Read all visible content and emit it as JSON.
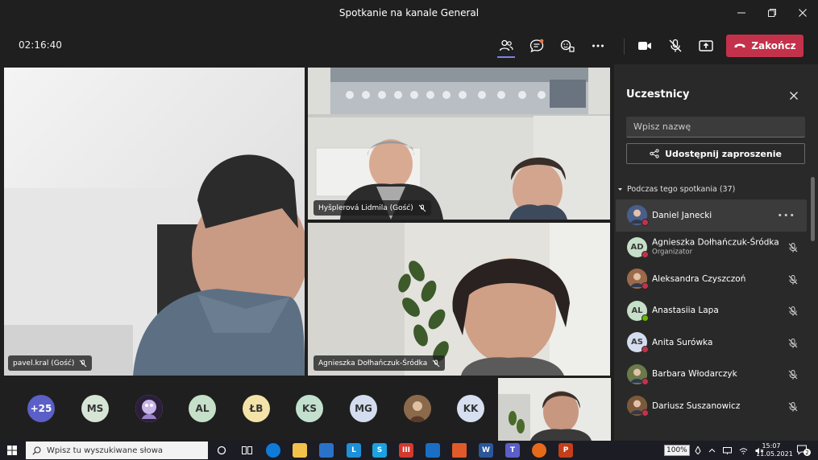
{
  "window": {
    "title": "Spotkanie na kanale General"
  },
  "toolbar": {
    "timer": "02:16:40",
    "leave_label": "Zakończ"
  },
  "tiles": [
    {
      "name": "pavel.kral (Gość)"
    },
    {
      "name": "Hyšplerová Lidmila (Gość)"
    },
    {
      "name": "Agnieszka Dołhańczuk-Śródka"
    }
  ],
  "strip": [
    {
      "label": "+25",
      "color": "#5b5fc7"
    },
    {
      "label": "MS",
      "color": "#d6e5d6"
    },
    {
      "label": "",
      "color": "#b49bd0"
    },
    {
      "label": "AL",
      "color": "#c6dfc8"
    },
    {
      "label": "ŁB",
      "color": "#f3e3a8"
    },
    {
      "label": "KS",
      "color": "#c3e0cf"
    },
    {
      "label": "MG",
      "color": "#d4ddee"
    },
    {
      "label": "",
      "color": "#a0784e"
    },
    {
      "label": "KK",
      "color": "#d6e0f0"
    }
  ],
  "panel": {
    "title": "Uczestnicy",
    "search_placeholder": "Wpisz nazwę",
    "invite_label": "Udostępnij zaproszenie",
    "section_label": "Podczas tego spotkania (37)",
    "participants": [
      {
        "name": "Daniel Janecki",
        "initials": "",
        "avatar": "#4a5e8a",
        "status": "#c4314b",
        "role": "",
        "highlight": true
      },
      {
        "name": "Agnieszka Dołhańczuk-Śródka",
        "initials": "AD",
        "avatar": "#c6dfc8",
        "status": "#c4314b",
        "role": "Organizator"
      },
      {
        "name": "Aleksandra Czyszczoń",
        "initials": "",
        "avatar": "#9a6a4a",
        "status": "#c4314b",
        "role": ""
      },
      {
        "name": "Anastasiia Lapa",
        "initials": "AL",
        "avatar": "#c6dfc8",
        "status": "#6bb700",
        "role": ""
      },
      {
        "name": "Anita Surówka",
        "initials": "AS",
        "avatar": "#d4ddee",
        "status": "#c4314b",
        "role": ""
      },
      {
        "name": "Barbara Włodarczyk",
        "initials": "",
        "avatar": "#6a7a4a",
        "status": "#c4314b",
        "role": ""
      },
      {
        "name": "Dariusz Suszanowicz",
        "initials": "",
        "avatar": "#7a5a3a",
        "status": "#c4314b",
        "role": ""
      }
    ]
  },
  "taskbar": {
    "search_placeholder": "Wpisz tu wyszukiwane słowa",
    "battery": "100%",
    "time": "15:07",
    "date": "11.05.2021",
    "notifications": "2"
  },
  "colors": {
    "accent": "#7b83eb",
    "leave": "#c4314b",
    "panel_bg": "#292929",
    "app_bg": "#1f1f1f"
  }
}
